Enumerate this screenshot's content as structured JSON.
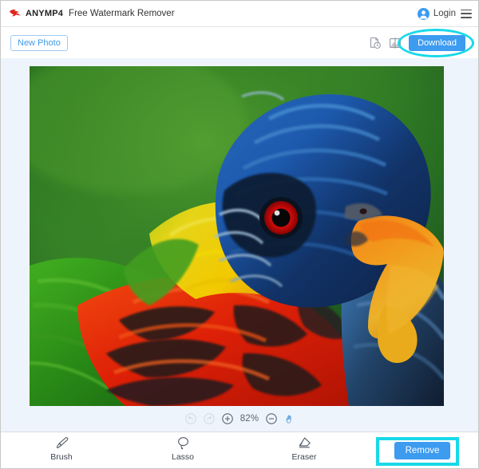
{
  "header": {
    "brand": "ANYMP4",
    "brand_logo_icon": "anymp4-bird-logo-icon",
    "app_title": "Free Watermark Remover",
    "login_label": "Login",
    "avatar_icon": "user-avatar-icon",
    "menu_icon": "hamburger-menu-icon",
    "accent_blue": "#3d9bf0"
  },
  "toolbar": {
    "new_photo_label": "New Photo",
    "history_icon": "history-clock-icon",
    "compare_icon": "compare-image-icon",
    "download_label": "Download",
    "annotation_color": "#18d9e8",
    "annotation_shape": "ellipse-highlight"
  },
  "canvas": {
    "background_color": "#eef4fc",
    "image_alt": "rainbow-lorikeet-parrot-photo",
    "zoom": {
      "undo_icon": "undo-icon",
      "redo_icon": "redo-icon",
      "zoom_in_icon": "zoom-in-icon",
      "zoom_out_icon": "zoom-out-icon",
      "pan_icon": "hand-pan-icon",
      "level": "82%"
    }
  },
  "bottombar": {
    "tools": [
      {
        "label": "Brush",
        "icon": "brush-icon"
      },
      {
        "label": "Lasso",
        "icon": "lasso-icon"
      },
      {
        "label": "Eraser",
        "icon": "eraser-icon"
      }
    ],
    "remove_label": "Remove",
    "annotation_color": "#18d9e8",
    "annotation_shape": "rectangle-highlight"
  }
}
